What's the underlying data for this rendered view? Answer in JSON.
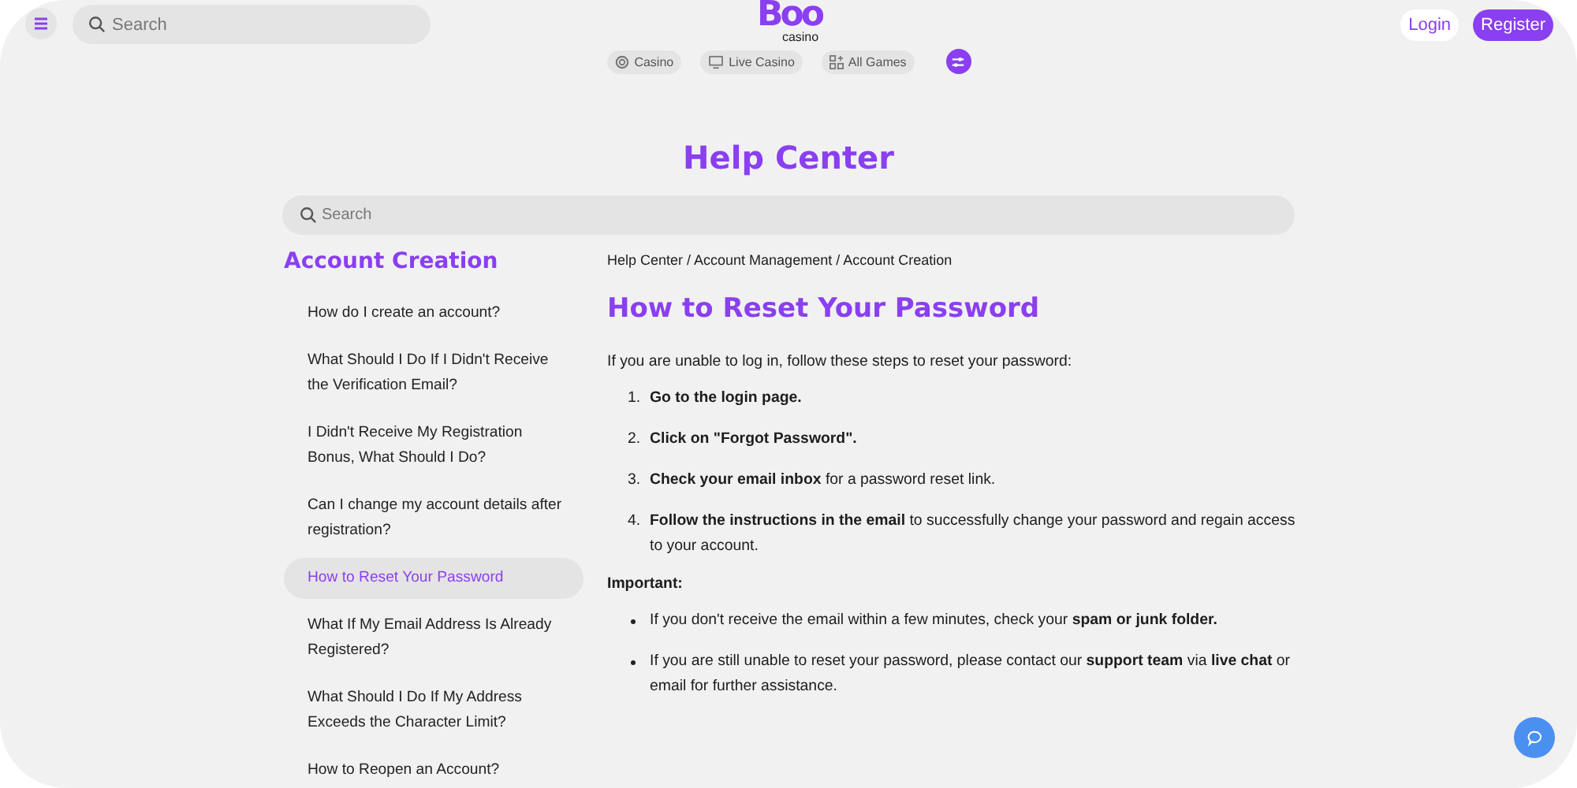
{
  "header": {
    "search": {
      "placeholder": "Search"
    },
    "logo": {
      "mark": "Boo",
      "sub": "casino"
    },
    "nav": [
      {
        "label": "Casino",
        "kind": "chip"
      },
      {
        "label": "Live Casino",
        "kind": "screen"
      },
      {
        "label": "All Games",
        "kind": "grid"
      }
    ],
    "login": "Login",
    "register": "Register"
  },
  "page_title": "Help Center",
  "help_search": {
    "placeholder": "Search"
  },
  "sidebar": {
    "heading": "Account Creation",
    "items": [
      {
        "label": "How do I create an account?",
        "selected": false
      },
      {
        "label": "What Should I Do If I Didn't Receive the Verification Email?",
        "selected": false
      },
      {
        "label": "I Didn't Receive My Registration Bonus, What Should I Do?",
        "selected": false
      },
      {
        "label": "Can I change my account details after registration?",
        "selected": false
      },
      {
        "label": "How to Reset Your Password",
        "selected": true
      },
      {
        "label": "What If My Email Address Is Already Registered?",
        "selected": false
      },
      {
        "label": "What Should I Do If My Address Exceeds the Character Limit?",
        "selected": false
      },
      {
        "label": "How to Reopen an Account?",
        "selected": false
      }
    ]
  },
  "article": {
    "breadcrumb": "Help Center / Account Management / Account Creation",
    "title": "How to Reset Your Password",
    "intro": "If you are unable to log in, follow these steps to reset your password:",
    "steps": [
      {
        "number": "1.",
        "text": "**Go to the login page.**"
      },
      {
        "number": "2.",
        "text": "**Click on \"Forgot Password\".**"
      },
      {
        "number": "3.",
        "text": "**Check your email inbox** for a password reset link."
      },
      {
        "number": "4.",
        "text": "**Follow the instructions in the email** to successfully change your password and regain access to your account."
      }
    ],
    "important": "Important:",
    "notes": [
      "If you don't receive the email within a few minutes, check your **spam or junk folder.**",
      "If you are still unable to reset your password, please contact our **support team** via **live chat** or email for further assistance."
    ]
  }
}
